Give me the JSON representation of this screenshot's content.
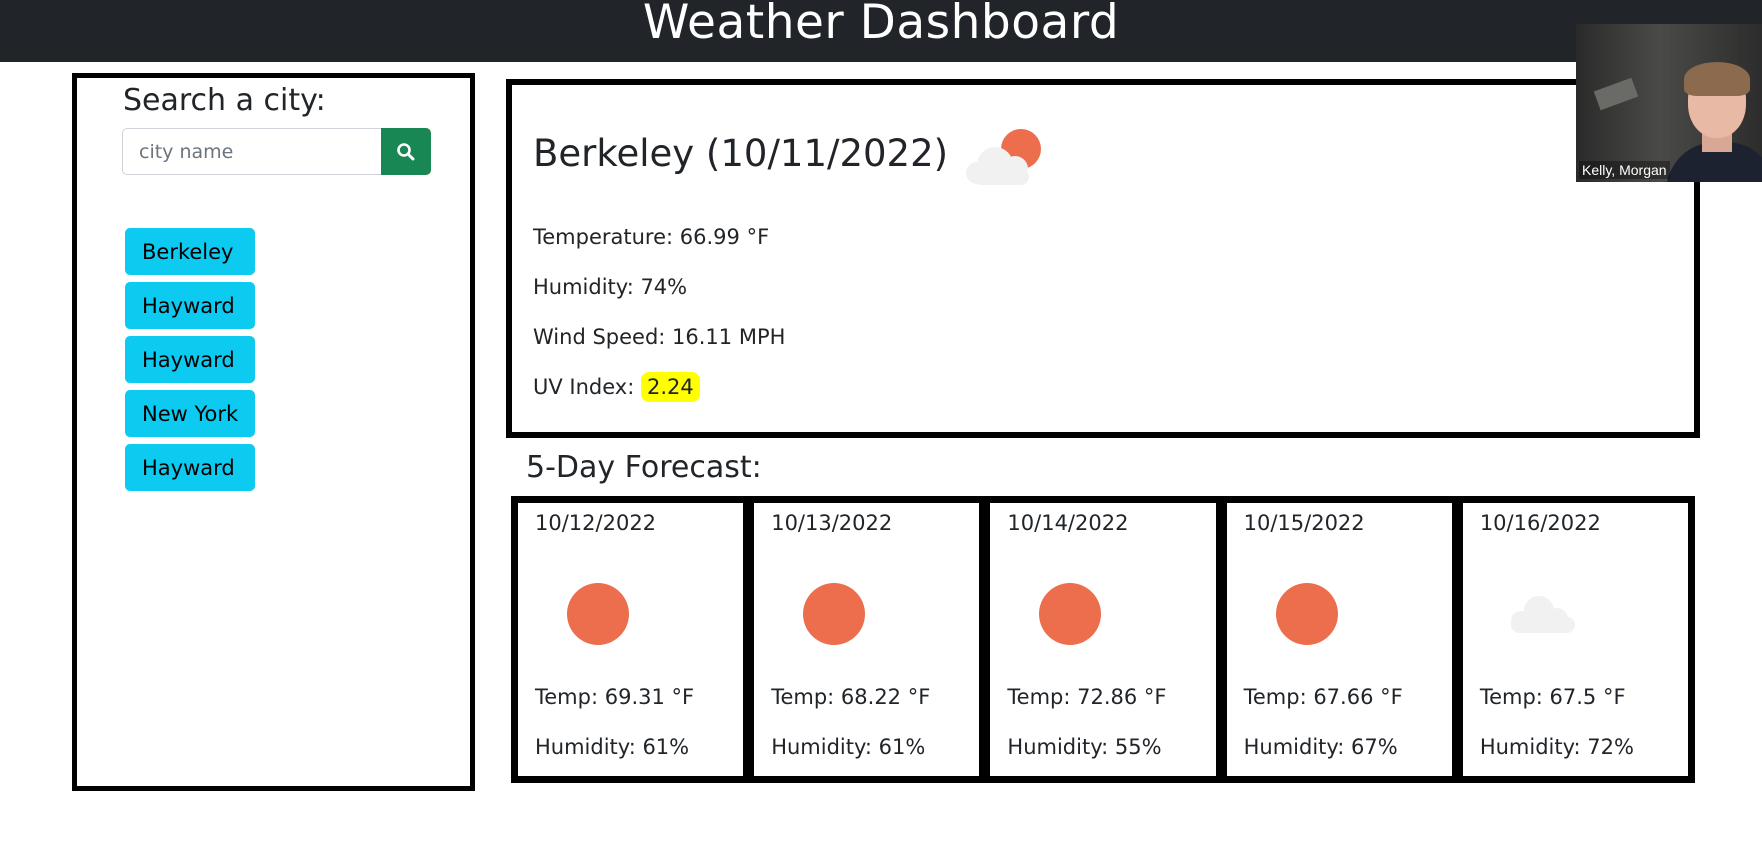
{
  "header": {
    "title": "Weather Dashboard"
  },
  "search": {
    "label": "Search a city:",
    "placeholder": "city name",
    "button_icon": "search-icon"
  },
  "history": {
    "cities": [
      "Berkeley",
      "Hayward",
      "Hayward",
      "New York",
      "Hayward"
    ]
  },
  "current": {
    "title": "Berkeley (10/11/2022)",
    "icon": "partly-cloudy-icon",
    "temperature": "Temperature: 66.99 °F",
    "humidity": "Humidity: 74%",
    "wind": "Wind Speed: 16.11 MPH",
    "uv_label": "UV Index: ",
    "uv_value": "2.24",
    "uv_color": "#ffff00"
  },
  "forecast": {
    "title": "5-Day Forecast:",
    "days": [
      {
        "date": "10/12/2022",
        "icon": "sun-icon",
        "temp": "Temp: 69.31 °F",
        "humidity": "Humidity: 61%"
      },
      {
        "date": "10/13/2022",
        "icon": "sun-icon",
        "temp": "Temp: 68.22 °F",
        "humidity": "Humidity: 61%"
      },
      {
        "date": "10/14/2022",
        "icon": "sun-icon",
        "temp": "Temp: 72.86 °F",
        "humidity": "Humidity: 55%"
      },
      {
        "date": "10/15/2022",
        "icon": "sun-icon",
        "temp": "Temp: 67.66 °F",
        "humidity": "Humidity: 67%"
      },
      {
        "date": "10/16/2022",
        "icon": "cloud-icon",
        "temp": "Temp: 67.5 °F",
        "humidity": "Humidity: 72%"
      }
    ]
  },
  "video_overlay": {
    "name": "Kelly, Morgan"
  },
  "colors": {
    "header_bg": "#212529",
    "search_button": "#198754",
    "city_button": "#0dcaf0",
    "sun": "#ec6e4c",
    "cloud": "#f1f1f1"
  }
}
